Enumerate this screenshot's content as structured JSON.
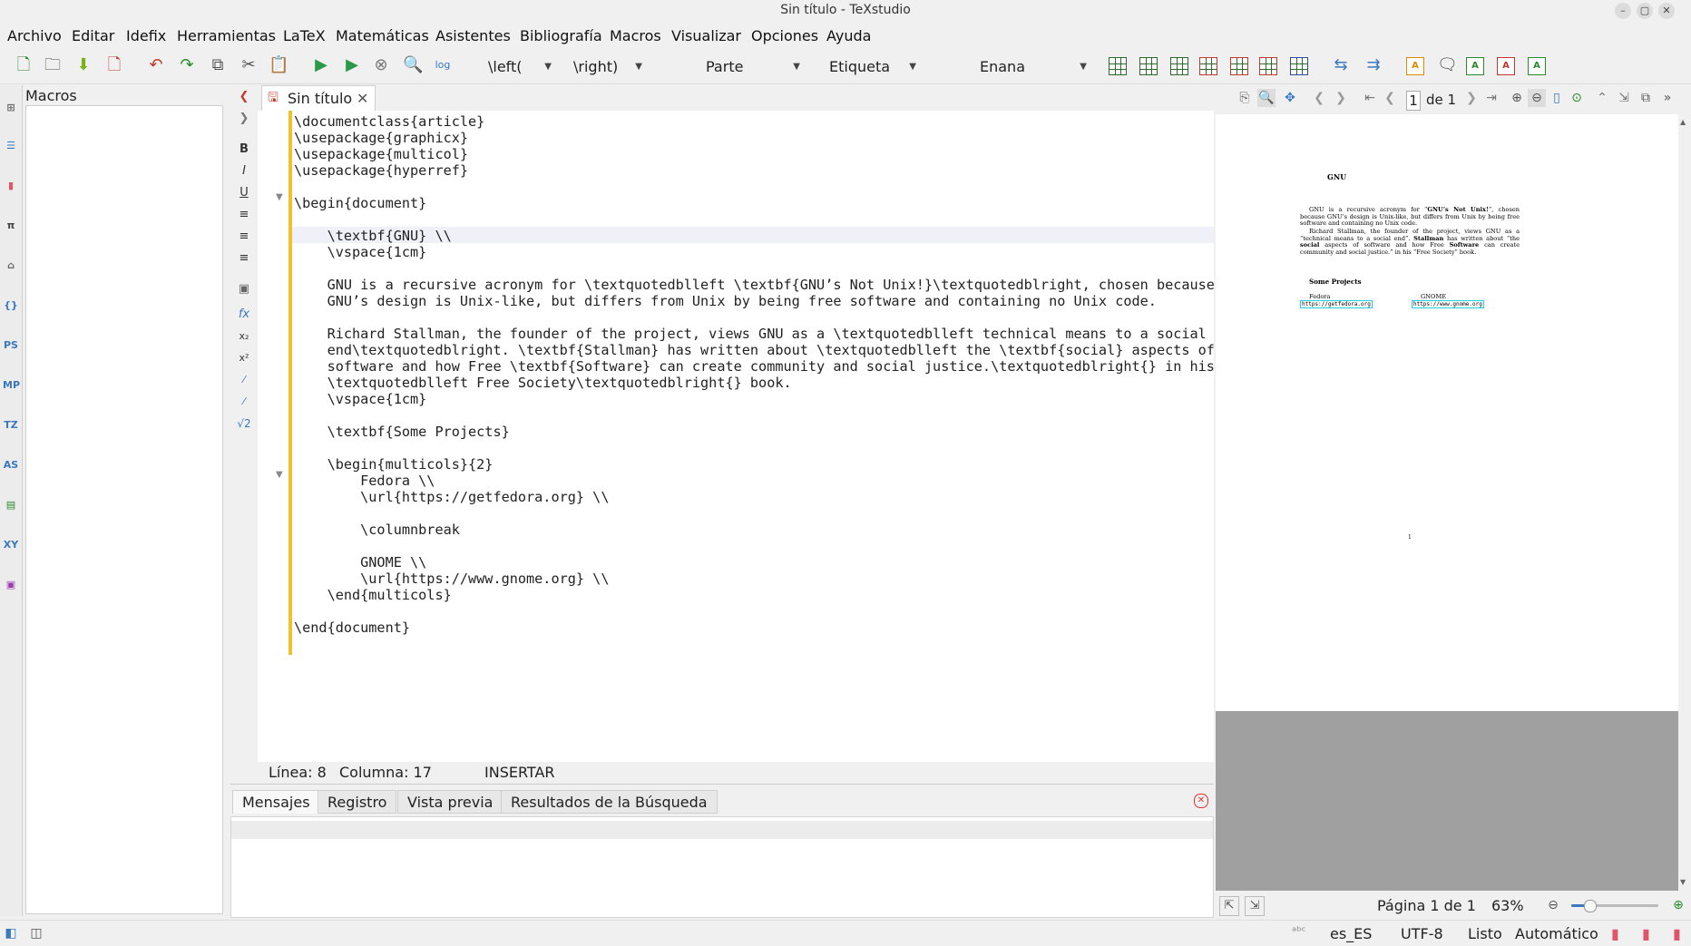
{
  "window": {
    "title": "Sin título - TeXstudio"
  },
  "menu": [
    "Archivo",
    "Editar",
    "Idefix",
    "Herramientas",
    "LaTeX",
    "Matemáticas",
    "Asistentes",
    "Bibliografía",
    "Macros",
    "Visualizar",
    "Opciones",
    "Ayuda"
  ],
  "toolbar": {
    "left_combo": "\\left(",
    "right_combo": "\\right)",
    "section_combo": "Parte",
    "label_combo": "Etiqueta",
    "size_combo": "Enana"
  },
  "leftbar": {
    "labels": [
      "PS",
      "MP",
      "TZ",
      "AS",
      "XY"
    ]
  },
  "macros": {
    "title": "Macros"
  },
  "editor": {
    "tab_title": "Sin título",
    "lines": [
      "\\documentclass{article}",
      "\\usepackage{graphicx}",
      "\\usepackage{multicol}",
      "\\usepackage{hyperref}",
      "",
      "\\begin{document}",
      "",
      "    \\textbf{GNU} \\\\",
      "    \\vspace{1cm}",
      "",
      "    GNU is a recursive acronym for \\textquotedblleft \\textbf{GNU’s Not Unix!}\\textquotedblright, chosen because",
      "    GNU’s design is Unix-like, but differs from Unix by being free software and containing no Unix code.",
      "",
      "    Richard Stallman, the founder of the project, views GNU as a \\textquotedblleft technical means to a social",
      "    end\\textquotedblright. \\textbf{Stallman} has written about \\textquotedblleft the \\textbf{social} aspects of",
      "    software and how Free \\textbf{Software} can create community and social justice.\\textquotedblright{} in his",
      "    \\textquotedblleft Free Society\\textquotedblright{} book.",
      "    \\vspace{1cm}",
      "",
      "    \\textbf{Some Projects}",
      "",
      "    \\begin{multicols}{2}",
      "        Fedora \\\\",
      "        \\url{https://getfedora.org} \\\\",
      "",
      "        \\columnbreak",
      "",
      "        GNOME \\\\",
      "        \\url{https://www.gnome.org} \\\\",
      "    \\end{multicols}",
      "",
      "\\end{document}"
    ],
    "status": {
      "line": "Línea: 8",
      "column": "Columna: 17",
      "mode": "INSERTAR"
    }
  },
  "messages": {
    "tabs": [
      "Mensajes",
      "Registro",
      "Vista previa",
      "Resultados de la Búsqueda"
    ]
  },
  "viewer": {
    "page_input": "1",
    "page_of": "de 1",
    "pdf": {
      "heading": "GNU",
      "para1_a": "GNU is a recursive acronym for “",
      "para1_bold": "GNU’s Not Unix!",
      "para1_b": "”, chosen because GNU’s design is Unix-like, but differs from Unix by being free software and containing no Unix code.",
      "para2_a": "Richard Stallman, the founder of the project, views GNU as a “technical means to a social end”. ",
      "para2_bold1": "Stallman",
      "para2_b": " has written about “the ",
      "para2_bold2": "social",
      "para2_c": " aspects of software and how Free ",
      "para2_bold3": "Software",
      "para2_d": " can create community and social justice.” in his “Free Society” book.",
      "section": "Some Projects",
      "col1_name": "Fedora",
      "col1_url": "https://getfedora.org",
      "col2_name": "GNOME",
      "col2_url": "https://www.gnome.org",
      "page_number": "1"
    },
    "status": {
      "page": "Página 1 de 1",
      "zoom": "63%"
    }
  },
  "statusbar": {
    "language": "es_ES",
    "encoding": "UTF-8",
    "state": "Listo",
    "mode": "Automático"
  }
}
